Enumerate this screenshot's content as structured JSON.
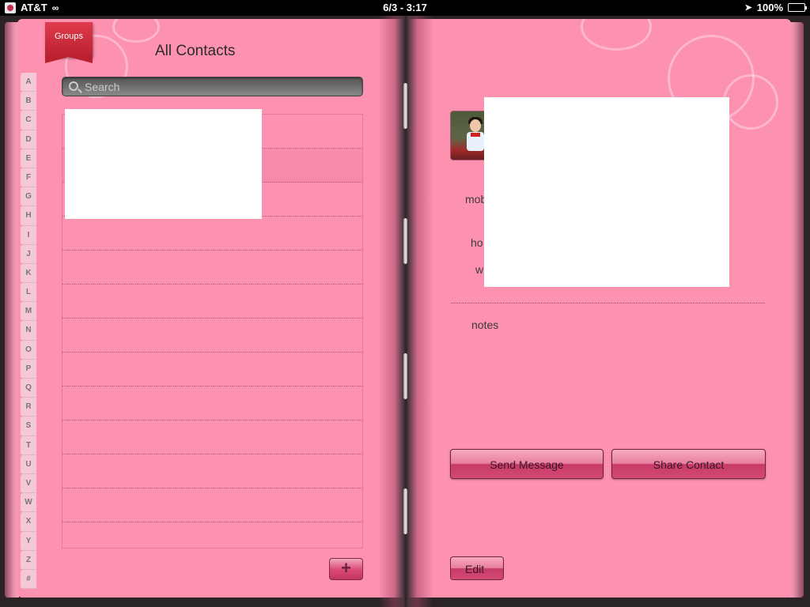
{
  "status_bar": {
    "carrier": "AT&T",
    "time": "6/3 - 3:17",
    "battery_percent": "100%",
    "battery_level": 1.0
  },
  "left_page": {
    "groups_label": "Groups",
    "title": "All Contacts",
    "search_placeholder": "Search",
    "index_letters": [
      "A",
      "B",
      "C",
      "D",
      "E",
      "F",
      "G",
      "H",
      "I",
      "J",
      "K",
      "L",
      "M",
      "N",
      "O",
      "P",
      "Q",
      "R",
      "S",
      "T",
      "U",
      "V",
      "W",
      "X",
      "Y",
      "Z",
      "#"
    ],
    "add_label": "+"
  },
  "right_page": {
    "labels": {
      "mobile": "mob",
      "home": "ho",
      "work": "w",
      "notes": "notes"
    },
    "send_message_label": "Send Message",
    "share_contact_label": "Share Contact",
    "edit_label": "Edit"
  },
  "colors": {
    "page": "#fd91b0",
    "ribbon": "#d02f3f",
    "button": "#d34a74"
  }
}
